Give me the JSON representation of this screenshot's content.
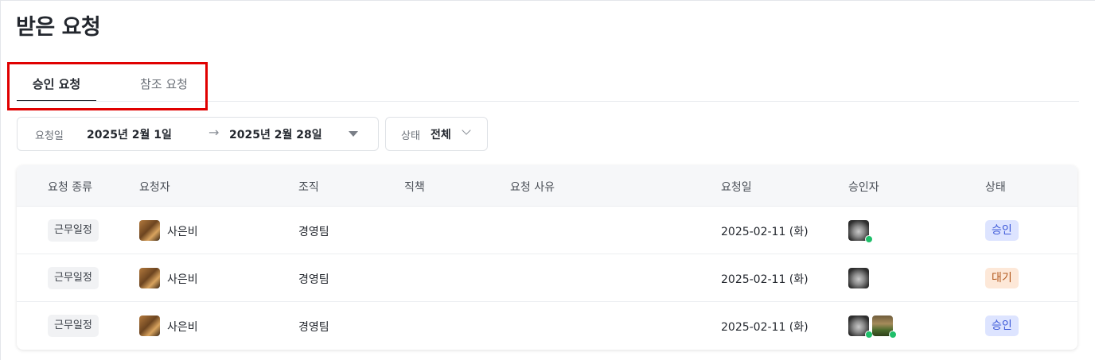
{
  "page": {
    "title": "받은 요청"
  },
  "tabs": [
    {
      "label": "승인 요청",
      "active": true
    },
    {
      "label": "참조 요청",
      "active": false
    }
  ],
  "filters": {
    "date": {
      "label": "요청일",
      "from": "2025년 2월 1일",
      "arrow": "→",
      "to": "2025년 2월 28일"
    },
    "status": {
      "label": "상태",
      "value": "전체"
    }
  },
  "table": {
    "columns": [
      "요청 종류",
      "요청자",
      "조직",
      "직책",
      "요청 사유",
      "요청일",
      "승인자",
      "상태"
    ],
    "rows": [
      {
        "type": "근무일정",
        "requester": "사은비",
        "org": "경영팀",
        "position": "",
        "reason": "",
        "date": "2025-02-11 (화)",
        "approvers": [
          "gray-avatar-approved"
        ],
        "status": "승인"
      },
      {
        "type": "근무일정",
        "requester": "사은비",
        "org": "경영팀",
        "position": "",
        "reason": "",
        "date": "2025-02-11 (화)",
        "approvers": [
          "gray-avatar"
        ],
        "status": "대기"
      },
      {
        "type": "근무일정",
        "requester": "사은비",
        "org": "경영팀",
        "position": "",
        "reason": "",
        "date": "2025-02-11 (화)",
        "approvers": [
          "gray-avatar-approved",
          "green-avatar-approved"
        ],
        "status": "승인"
      }
    ]
  },
  "colors": {
    "highlight": "#e00000",
    "approved_bg": "#dde4ff",
    "approved_fg": "#3f5bd9",
    "waiting_bg": "#fde8d8",
    "waiting_fg": "#b35a1f",
    "check": "#1fbf6a"
  }
}
